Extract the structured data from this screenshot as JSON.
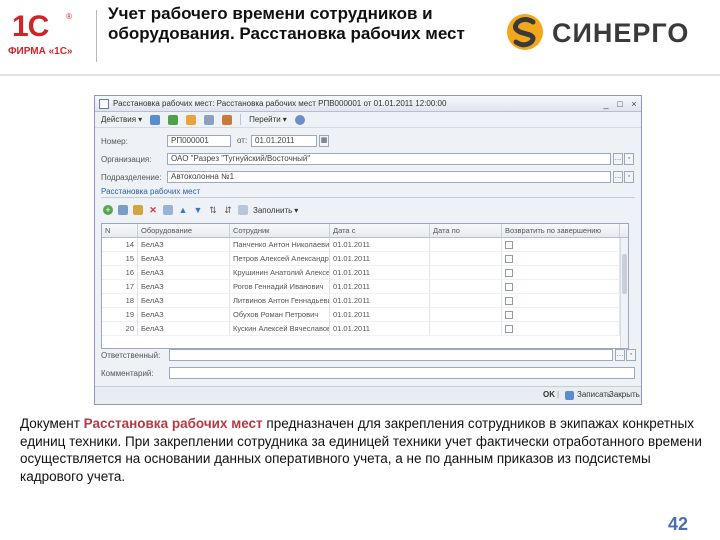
{
  "header": {
    "logo_1c_mark": "1С",
    "logo_1c_text": "ФИРМА «1С»",
    "title": "Учет рабочего времени сотрудников и оборудования. Расстановка рабочих мест",
    "partner_logo_text": "СИНЕРГО"
  },
  "window": {
    "title": "Расстановка рабочих мест: Расстановка рабочих мест РПВ000001 от 01.01.2011 12:00:00",
    "toolbar": {
      "actions_label": "Действия",
      "goto_label": "Перейти"
    },
    "form": {
      "number_label": "Номер:",
      "number_value": "РП000001",
      "from_label": "от:",
      "date_value": "01.01.2011",
      "org_label": "Организация:",
      "org_value": "ОАО \"Разрез \"Тугнуйский/Восточный\"",
      "dept_label": "Подразделение:",
      "dept_value": "Автоколонна №1"
    },
    "section_title": "Расстановка рабочих мест",
    "table_toolbar": {
      "fill_label": "Заполнить"
    },
    "table": {
      "columns": [
        "N",
        "Оборудование",
        "Сотрудник",
        "Дата с",
        "Дата по",
        "Возвратить по завершению"
      ],
      "rows": [
        {
          "n": "14",
          "equipment": "БелАЗ",
          "employee": "Панченко Антон Николаевич",
          "date_from": "01.01.2011",
          "date_to": ""
        },
        {
          "n": "15",
          "equipment": "БелАЗ",
          "employee": "Петров Алексей Александрович",
          "date_from": "01.01.2011",
          "date_to": ""
        },
        {
          "n": "16",
          "equipment": "БелАЗ",
          "employee": "Крушинин Анатолий Алексеевич",
          "date_from": "01.01.2011",
          "date_to": ""
        },
        {
          "n": "17",
          "equipment": "БелАЗ",
          "employee": "Рогов Геннадий Иванович",
          "date_from": "01.01.2011",
          "date_to": ""
        },
        {
          "n": "18",
          "equipment": "БелАЗ",
          "employee": "Литвинов Антон Геннадьевич",
          "date_from": "01.01.2011",
          "date_to": ""
        },
        {
          "n": "19",
          "equipment": "БелАЗ",
          "employee": "Обухов Роман Петрович",
          "date_from": "01.01.2011",
          "date_to": ""
        },
        {
          "n": "20",
          "equipment": "БелАЗ",
          "employee": "Кускин Алексей Вячеславович",
          "date_from": "01.01.2011",
          "date_to": ""
        }
      ]
    },
    "responsible_label": "Ответственный:",
    "comment_label": "Комментарий:",
    "buttons": {
      "ok": "OK",
      "save": "Записать",
      "close": "Закрыть"
    }
  },
  "description": {
    "prefix": "Документ ",
    "highlight": "Расстановка рабочих мест",
    "rest": " предназначен для закрепления сотрудников в экипажах конкретных единиц техники. При закреплении сотрудника за единицей техники учет фактически отработанного времени осуществляется на основании данных оперативного учета, а не по данным приказов из подсистемы кадрового учета."
  },
  "page_number": "42",
  "colors": {
    "brand_red": "#d0242a",
    "highlight": "#b53a45",
    "page_number": "#4a6fb0",
    "section_title": "#3060a8"
  }
}
